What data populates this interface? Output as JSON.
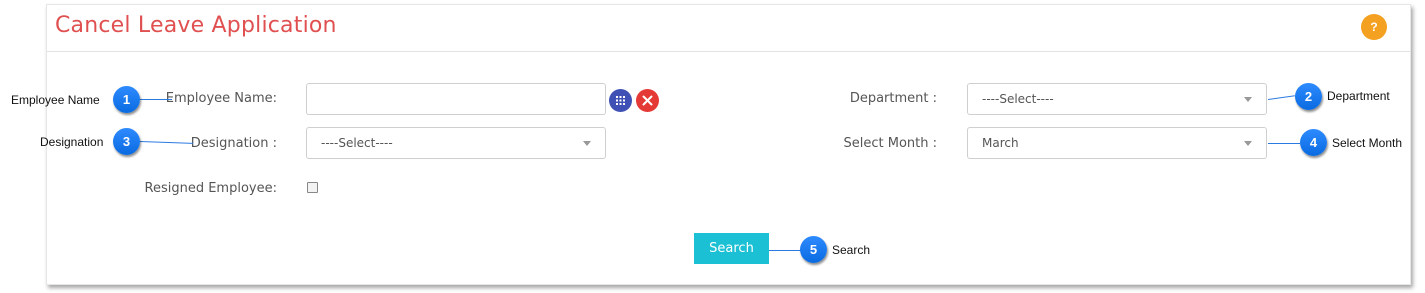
{
  "title": "Cancel Leave Application",
  "help_label": "?",
  "form": {
    "employee_name_label": "Employee Name:",
    "employee_name_value": "",
    "department_label": "Department :",
    "department_value": "----Select----",
    "designation_label": "Designation :",
    "designation_value": "----Select----",
    "select_month_label": "Select Month :",
    "select_month_value": "March",
    "resigned_label": "Resigned Employee:",
    "resigned_checked": false,
    "search_label": "Search"
  },
  "callouts": [
    {
      "number": "1",
      "text": "Employee Name"
    },
    {
      "number": "2",
      "text": "Department"
    },
    {
      "number": "3",
      "text": "Designation"
    },
    {
      "number": "4",
      "text": "Select Month"
    },
    {
      "number": "5",
      "text": "Search"
    }
  ],
  "colors": {
    "title": "#e05050",
    "help_button": "#f4a020",
    "search_button": "#1cc0d4",
    "badge": "#0a6ae0"
  }
}
